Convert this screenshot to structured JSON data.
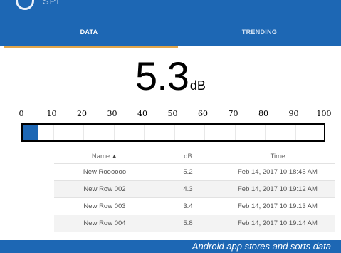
{
  "app": {
    "title": "SPL",
    "icon": "meter-icon",
    "brand_color": "#1d67b4",
    "accent_color": "#e2a64a"
  },
  "tabs": [
    {
      "label": "DATA",
      "active": true
    },
    {
      "label": "TRENDING",
      "active": false
    }
  ],
  "reading": {
    "value": "5.3",
    "unit": "dB"
  },
  "meter": {
    "scale_labels": [
      "0",
      "10",
      "20",
      "30",
      "40",
      "50",
      "60",
      "70",
      "80",
      "90",
      "100"
    ],
    "min": 0,
    "max": 100,
    "level": 5.3
  },
  "table": {
    "headers": {
      "name": "Name",
      "name_sort": "▲",
      "db": "dB",
      "time": "Time"
    },
    "rows": [
      {
        "name": "New Roooooo",
        "db": "5.2",
        "time": "Feb 14, 2017 10:18:45 AM"
      },
      {
        "name": "New Row 002",
        "db": "4.3",
        "time": "Feb 14, 2017 10:19:12 AM"
      },
      {
        "name": "New Row 003",
        "db": "3.4",
        "time": "Feb 14, 2017 10:19:13 AM"
      },
      {
        "name": "New Row 004",
        "db": "5.8",
        "time": "Feb 14, 2017 10:19:14 AM"
      }
    ]
  },
  "caption": "Android app stores and sorts data"
}
